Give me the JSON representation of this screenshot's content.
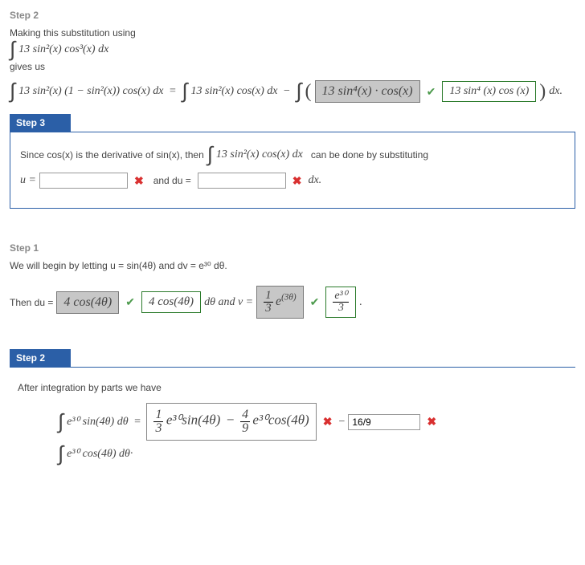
{
  "step2a": {
    "label": "Step 2",
    "intro": "Making this substitution using",
    "expr_start": "13 sin²(x) cos³(x) dx",
    "gives": "gives us",
    "long_left": "13 sin²(x) (1 − sin²(x)) cos(x) dx",
    "long_mid": "13 sin²(x) cos(x) dx",
    "ans1": "13 sin⁴(x) · cos(x)",
    "ans2": "13 sin⁴ (x) cos (x)",
    "trail": "dx."
  },
  "step3": {
    "label": "Step 3",
    "text_a": "Since  cos(x)  is the derivative of  sin(x),  then",
    "integral": "13 sin²(x) cos(x) dx",
    "text_b": "can be done by substituting",
    "u_eq": "u =",
    "and_du": "and  du =",
    "dx": "dx."
  },
  "step1": {
    "label": "Step 1",
    "text": "We will begin by letting  u = sin(4θ)  and  dv = e³⁰ dθ.",
    "then_du": "Then  du =",
    "du_ans1": "4 cos(4θ)",
    "du_ans2": "4 cos(4θ)",
    "dtheta_and_v": "dθ  and  v =",
    "v_ans1_num": "1",
    "v_ans1_den": "3",
    "v_ans1_rest": "e",
    "v_ans1_exp": "(3θ)",
    "v_ans2_num": "e³⁰",
    "v_ans2_den": "3"
  },
  "step2b": {
    "label": "Step 2",
    "text": "After integration by parts we have",
    "lhs_int": "e³⁰ sin(4θ) dθ",
    "box_frac1_num": "1",
    "box_frac1_den": "3",
    "box_mid1": "e³⁰sin(4θ)",
    "box_frac2_num": "4",
    "box_frac2_den": "9",
    "box_mid2": "e³⁰cos(4θ)",
    "minus": "−",
    "ans": "16/9",
    "second_int": "e³⁰ cos(4θ) dθ·"
  }
}
